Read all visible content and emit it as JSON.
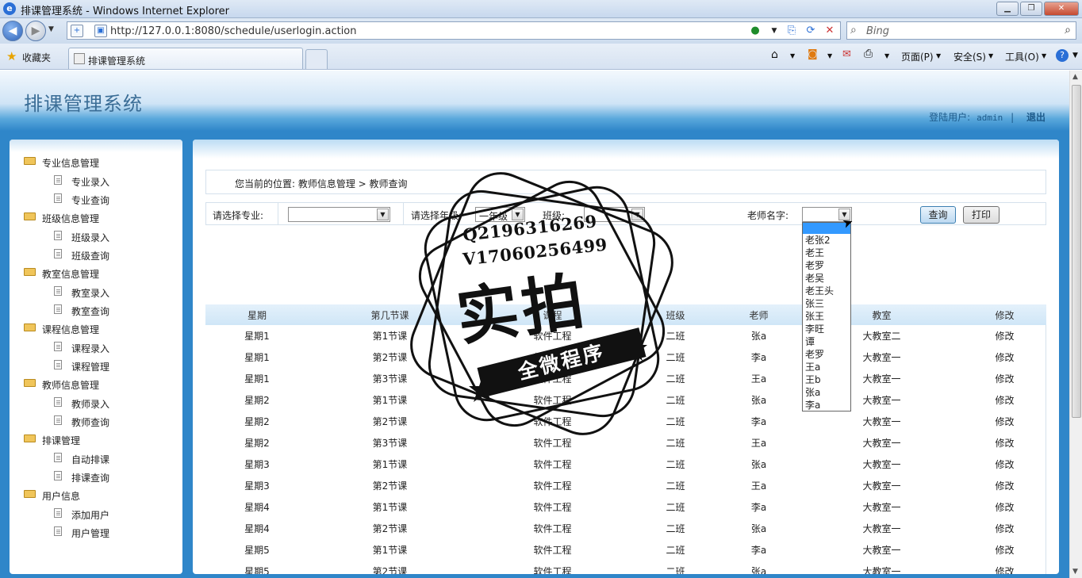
{
  "window": {
    "title": "排课管理系统 - Windows Internet Explorer",
    "buttons": [
      "▁",
      "❐",
      "✕"
    ]
  },
  "browser": {
    "url": "http://127.0.0.1:8080/schedule/userlogin.action",
    "search_placeholder": "Bing",
    "favorites_label": "收藏夹",
    "tab_title": "排课管理系统",
    "commands": [
      "页面(P)",
      "安全(S)",
      "工具(O)"
    ]
  },
  "app": {
    "title": "排课管理系统",
    "user_label": "登陆用户:",
    "username": "admin",
    "separator": "|",
    "logout": "退出"
  },
  "sidebar": {
    "groups": [
      {
        "label": "专业信息管理",
        "items": [
          "专业录入",
          "专业查询"
        ]
      },
      {
        "label": "班级信息管理",
        "items": [
          "班级录入",
          "班级查询"
        ]
      },
      {
        "label": "教室信息管理",
        "items": [
          "教室录入",
          "教室查询"
        ]
      },
      {
        "label": "课程信息管理",
        "items": [
          "课程录入",
          "课程管理"
        ]
      },
      {
        "label": "教师信息管理",
        "items": [
          "教师录入",
          "教师查询"
        ]
      },
      {
        "label": "排课管理",
        "items": [
          "自动排课",
          "排课查询"
        ]
      },
      {
        "label": "用户信息",
        "items": [
          "添加用户",
          "用户管理"
        ]
      }
    ]
  },
  "breadcrumb": "您当前的位置:  教师信息管理 > 教师查询",
  "filters": {
    "major_label": "请选择专业:",
    "major_value": "",
    "grade_label": "请选择年级:",
    "grade_value": "一年级",
    "class_label": "班级:",
    "class_value": "",
    "teacher_label": "老师名字:",
    "teacher_value": "",
    "query_button": "查询",
    "print_button": "打印"
  },
  "table": {
    "columns": [
      "星期",
      "第几节课",
      "课程",
      "班级",
      "老师",
      "教室",
      "修改"
    ],
    "rows": [
      [
        "星期1",
        "第1节课",
        "软件工程",
        "二班",
        "张a",
        "大教室二",
        "修改"
      ],
      [
        "星期1",
        "第2节课",
        "软件工程",
        "二班",
        "李a",
        "大教室一",
        "修改"
      ],
      [
        "星期1",
        "第3节课",
        "软件工程",
        "二班",
        "王a",
        "大教室一",
        "修改"
      ],
      [
        "星期2",
        "第1节课",
        "软件工程",
        "二班",
        "张a",
        "大教室一",
        "修改"
      ],
      [
        "星期2",
        "第2节课",
        "软件工程",
        "二班",
        "李a",
        "大教室一",
        "修改"
      ],
      [
        "星期2",
        "第3节课",
        "软件工程",
        "二班",
        "王a",
        "大教室一",
        "修改"
      ],
      [
        "星期3",
        "第1节课",
        "软件工程",
        "二班",
        "张a",
        "大教室一",
        "修改"
      ],
      [
        "星期3",
        "第2节课",
        "软件工程",
        "二班",
        "王a",
        "大教室一",
        "修改"
      ],
      [
        "星期4",
        "第1节课",
        "软件工程",
        "二班",
        "李a",
        "大教室一",
        "修改"
      ],
      [
        "星期4",
        "第2节课",
        "软件工程",
        "二班",
        "张a",
        "大教室一",
        "修改"
      ],
      [
        "星期5",
        "第1节课",
        "软件工程",
        "二班",
        "李a",
        "大教室一",
        "修改"
      ],
      [
        "星期5",
        "第2节课",
        "软件工程",
        "二班",
        "张a",
        "大教室一",
        "修改"
      ]
    ]
  },
  "teacher_dropdown": {
    "options": [
      "",
      "老张2",
      "老王",
      "老罗",
      "老吴",
      "老王头",
      "张三",
      "张王",
      "李旺",
      "谭",
      "老罗",
      "王a",
      "王b",
      "张a",
      "李a"
    ]
  },
  "watermark": {
    "line1": "Q2196316269",
    "line2": "V17060256499",
    "main": "实拍",
    "ribbon": "全微程序"
  }
}
